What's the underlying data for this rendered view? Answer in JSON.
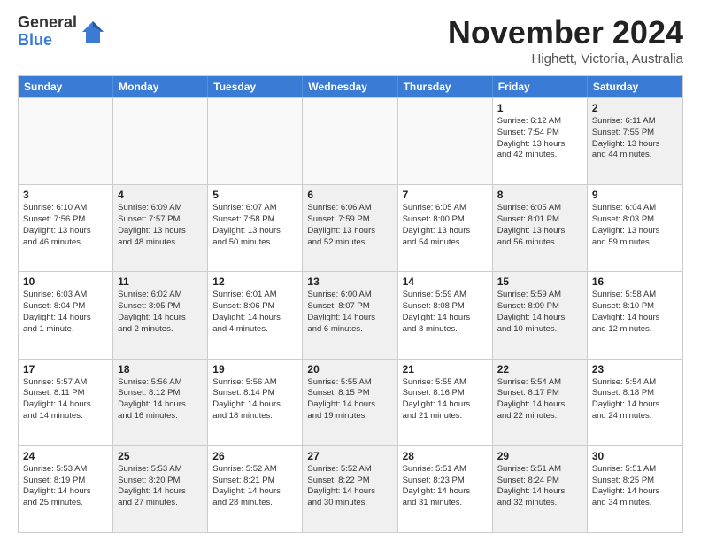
{
  "logo": {
    "general": "General",
    "blue": "Blue"
  },
  "title": "November 2024",
  "location": "Highett, Victoria, Australia",
  "days_of_week": [
    "Sunday",
    "Monday",
    "Tuesday",
    "Wednesday",
    "Thursday",
    "Friday",
    "Saturday"
  ],
  "rows": [
    [
      {
        "day": "",
        "info": "",
        "empty": true
      },
      {
        "day": "",
        "info": "",
        "empty": true
      },
      {
        "day": "",
        "info": "",
        "empty": true
      },
      {
        "day": "",
        "info": "",
        "empty": true
      },
      {
        "day": "",
        "info": "",
        "empty": true
      },
      {
        "day": "1",
        "info": "Sunrise: 6:12 AM\nSunset: 7:54 PM\nDaylight: 13 hours\nand 42 minutes.",
        "empty": false,
        "shaded": false
      },
      {
        "day": "2",
        "info": "Sunrise: 6:11 AM\nSunset: 7:55 PM\nDaylight: 13 hours\nand 44 minutes.",
        "empty": false,
        "shaded": true
      }
    ],
    [
      {
        "day": "3",
        "info": "Sunrise: 6:10 AM\nSunset: 7:56 PM\nDaylight: 13 hours\nand 46 minutes.",
        "empty": false,
        "shaded": false
      },
      {
        "day": "4",
        "info": "Sunrise: 6:09 AM\nSunset: 7:57 PM\nDaylight: 13 hours\nand 48 minutes.",
        "empty": false,
        "shaded": true
      },
      {
        "day": "5",
        "info": "Sunrise: 6:07 AM\nSunset: 7:58 PM\nDaylight: 13 hours\nand 50 minutes.",
        "empty": false,
        "shaded": false
      },
      {
        "day": "6",
        "info": "Sunrise: 6:06 AM\nSunset: 7:59 PM\nDaylight: 13 hours\nand 52 minutes.",
        "empty": false,
        "shaded": true
      },
      {
        "day": "7",
        "info": "Sunrise: 6:05 AM\nSunset: 8:00 PM\nDaylight: 13 hours\nand 54 minutes.",
        "empty": false,
        "shaded": false
      },
      {
        "day": "8",
        "info": "Sunrise: 6:05 AM\nSunset: 8:01 PM\nDaylight: 13 hours\nand 56 minutes.",
        "empty": false,
        "shaded": true
      },
      {
        "day": "9",
        "info": "Sunrise: 6:04 AM\nSunset: 8:03 PM\nDaylight: 13 hours\nand 59 minutes.",
        "empty": false,
        "shaded": false
      }
    ],
    [
      {
        "day": "10",
        "info": "Sunrise: 6:03 AM\nSunset: 8:04 PM\nDaylight: 14 hours\nand 1 minute.",
        "empty": false,
        "shaded": false
      },
      {
        "day": "11",
        "info": "Sunrise: 6:02 AM\nSunset: 8:05 PM\nDaylight: 14 hours\nand 2 minutes.",
        "empty": false,
        "shaded": true
      },
      {
        "day": "12",
        "info": "Sunrise: 6:01 AM\nSunset: 8:06 PM\nDaylight: 14 hours\nand 4 minutes.",
        "empty": false,
        "shaded": false
      },
      {
        "day": "13",
        "info": "Sunrise: 6:00 AM\nSunset: 8:07 PM\nDaylight: 14 hours\nand 6 minutes.",
        "empty": false,
        "shaded": true
      },
      {
        "day": "14",
        "info": "Sunrise: 5:59 AM\nSunset: 8:08 PM\nDaylight: 14 hours\nand 8 minutes.",
        "empty": false,
        "shaded": false
      },
      {
        "day": "15",
        "info": "Sunrise: 5:59 AM\nSunset: 8:09 PM\nDaylight: 14 hours\nand 10 minutes.",
        "empty": false,
        "shaded": true
      },
      {
        "day": "16",
        "info": "Sunrise: 5:58 AM\nSunset: 8:10 PM\nDaylight: 14 hours\nand 12 minutes.",
        "empty": false,
        "shaded": false
      }
    ],
    [
      {
        "day": "17",
        "info": "Sunrise: 5:57 AM\nSunset: 8:11 PM\nDaylight: 14 hours\nand 14 minutes.",
        "empty": false,
        "shaded": false
      },
      {
        "day": "18",
        "info": "Sunrise: 5:56 AM\nSunset: 8:12 PM\nDaylight: 14 hours\nand 16 minutes.",
        "empty": false,
        "shaded": true
      },
      {
        "day": "19",
        "info": "Sunrise: 5:56 AM\nSunset: 8:14 PM\nDaylight: 14 hours\nand 18 minutes.",
        "empty": false,
        "shaded": false
      },
      {
        "day": "20",
        "info": "Sunrise: 5:55 AM\nSunset: 8:15 PM\nDaylight: 14 hours\nand 19 minutes.",
        "empty": false,
        "shaded": true
      },
      {
        "day": "21",
        "info": "Sunrise: 5:55 AM\nSunset: 8:16 PM\nDaylight: 14 hours\nand 21 minutes.",
        "empty": false,
        "shaded": false
      },
      {
        "day": "22",
        "info": "Sunrise: 5:54 AM\nSunset: 8:17 PM\nDaylight: 14 hours\nand 22 minutes.",
        "empty": false,
        "shaded": true
      },
      {
        "day": "23",
        "info": "Sunrise: 5:54 AM\nSunset: 8:18 PM\nDaylight: 14 hours\nand 24 minutes.",
        "empty": false,
        "shaded": false
      }
    ],
    [
      {
        "day": "24",
        "info": "Sunrise: 5:53 AM\nSunset: 8:19 PM\nDaylight: 14 hours\nand 25 minutes.",
        "empty": false,
        "shaded": false
      },
      {
        "day": "25",
        "info": "Sunrise: 5:53 AM\nSunset: 8:20 PM\nDaylight: 14 hours\nand 27 minutes.",
        "empty": false,
        "shaded": true
      },
      {
        "day": "26",
        "info": "Sunrise: 5:52 AM\nSunset: 8:21 PM\nDaylight: 14 hours\nand 28 minutes.",
        "empty": false,
        "shaded": false
      },
      {
        "day": "27",
        "info": "Sunrise: 5:52 AM\nSunset: 8:22 PM\nDaylight: 14 hours\nand 30 minutes.",
        "empty": false,
        "shaded": true
      },
      {
        "day": "28",
        "info": "Sunrise: 5:51 AM\nSunset: 8:23 PM\nDaylight: 14 hours\nand 31 minutes.",
        "empty": false,
        "shaded": false
      },
      {
        "day": "29",
        "info": "Sunrise: 5:51 AM\nSunset: 8:24 PM\nDaylight: 14 hours\nand 32 minutes.",
        "empty": false,
        "shaded": true
      },
      {
        "day": "30",
        "info": "Sunrise: 5:51 AM\nSunset: 8:25 PM\nDaylight: 14 hours\nand 34 minutes.",
        "empty": false,
        "shaded": false
      }
    ]
  ]
}
